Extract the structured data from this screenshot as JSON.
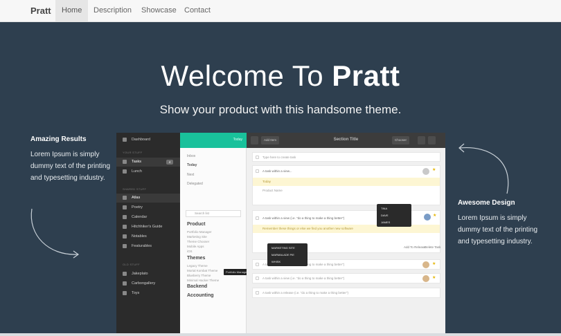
{
  "navbar": {
    "brand": "Pratt",
    "items": [
      {
        "label": "Home",
        "active": true
      },
      {
        "label": "Description",
        "active": false
      },
      {
        "label": "Showcase",
        "active": false
      },
      {
        "label": "Contact",
        "active": false
      }
    ]
  },
  "hero": {
    "title_light": "Welcome To ",
    "title_bold": "Pratt",
    "subtitle": "Show your product with this handsome theme."
  },
  "left_feature": {
    "title": "Amazing Results",
    "text": "Lorem Ipsum is simply dummy text of the printing and typesetting industry."
  },
  "right_feature": {
    "title": "Awesome Design",
    "text": "Lorem Ipsum is simply dummy text of the printing and typesetting industry."
  },
  "mock": {
    "sidebar": {
      "dashboard": "Dashboard",
      "your_stuff": "YOUR STUFF",
      "tasks": "Tasks",
      "tasks_count": "4",
      "lunch": "Lunch",
      "shared_stuff": "SHARED STUFF",
      "items": [
        "Atlas",
        "Poetry",
        "Calendar",
        "Hitchhiker's Guide",
        "Notables",
        "Featurables"
      ],
      "old_stuff": "OLD STUFF",
      "old_items": [
        "Jakeplato",
        "Carbongallery",
        "Toys"
      ]
    },
    "middle": {
      "today": "Today",
      "filters": [
        "Inbox",
        "Today",
        "Next",
        "Delegated"
      ],
      "search": "Search list",
      "product": "Product",
      "product_items": [
        "Portfolio Manager",
        "Marketing Site",
        "Theme Chooser",
        "Mobile Apps",
        "iOS"
      ],
      "themes": "Themes",
      "theme_items": [
        "Legacy Theme",
        "Mortal Kombat Theme",
        "Blueberry Theme",
        "Minimal Hacker Theme"
      ],
      "backend": "Backend",
      "accounting": "Accounting",
      "tooltip": "Portfolio Manager"
    },
    "main": {
      "add_item": "Add Item",
      "section_title": "Section Title",
      "chooser": "Chooser",
      "placeholder": "Type here to create task",
      "task1": "A task within a view...",
      "task1_note": "Today",
      "task1_sub": "Product Name",
      "task2": "A task within a view (i.e. \"do a thing to make a thing better\")",
      "task2_note": "Remember these things or else we find you another new software",
      "task3": "A task within a view (i.e. \"do a thing to make a thing better\")",
      "task4": "A task within a view (i.e. \"do a thing to make a thing better\")",
      "task5": "A task within a release (i.e. \"do a thing to make a thing better\")",
      "add_to_release": "Add To Release",
      "delete_task": "Delete Task",
      "popup1": [
        "TINA",
        "DAVE",
        "JAMES"
      ],
      "popup2": [
        "MARKETING SITE",
        "MARMALADE PIE",
        "WHISK"
      ]
    }
  }
}
